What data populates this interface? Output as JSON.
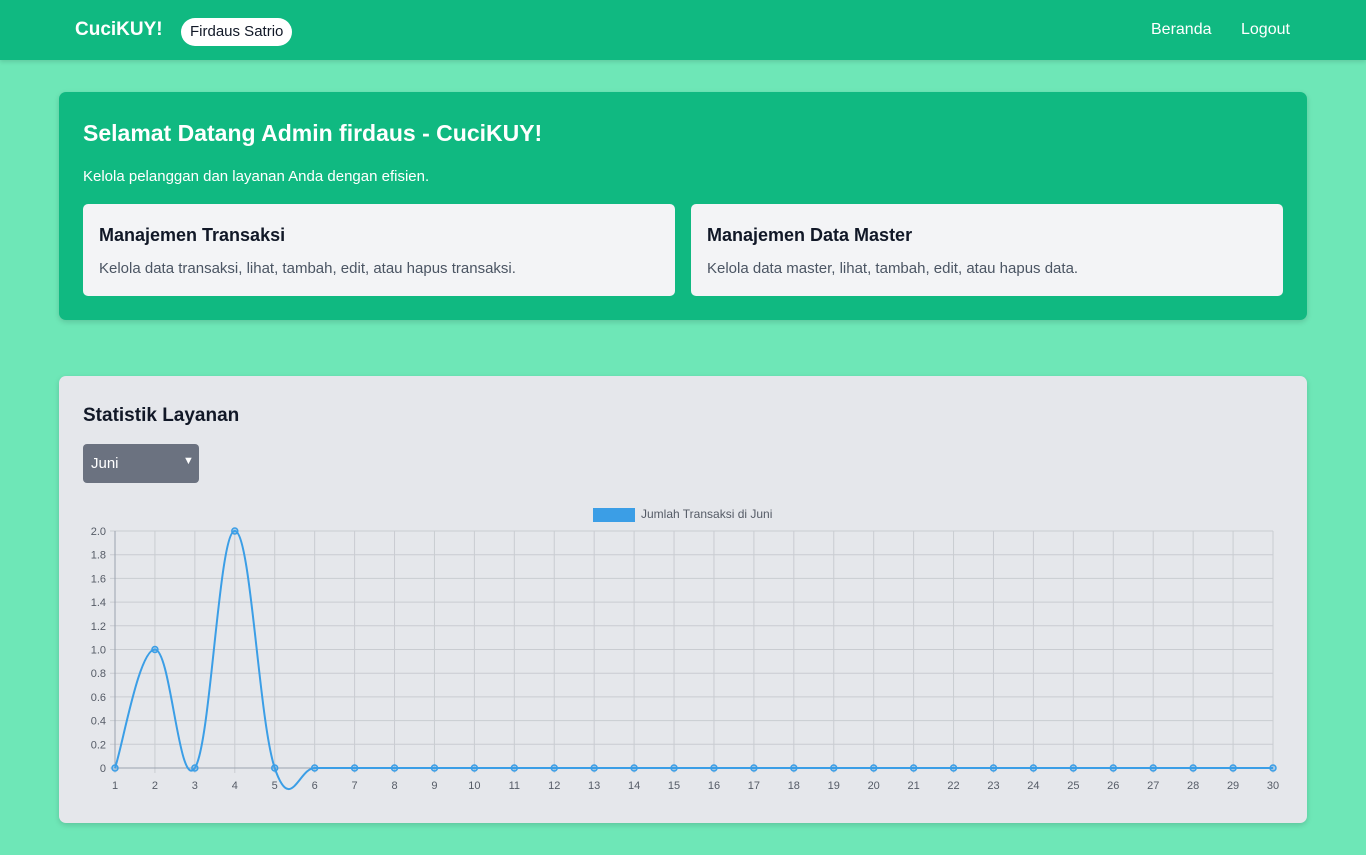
{
  "navbar": {
    "brand": "CuciKUY!",
    "user_name": "Firdaus Satrio",
    "links": {
      "home": "Beranda",
      "logout": "Logout"
    }
  },
  "hero": {
    "title": "Selamat Datang Admin firdaus - CuciKUY!",
    "subtitle": "Kelola pelanggan dan layanan Anda dengan efisien.",
    "cards": [
      {
        "title": "Manajemen Transaksi",
        "description": "Kelola data transaksi, lihat, tambah, edit, atau hapus transaksi."
      },
      {
        "title": "Manajemen Data Master",
        "description": "Kelola data master, lihat, tambah, edit, atau hapus data."
      }
    ]
  },
  "stats": {
    "title": "Statistik Layanan",
    "month_select": {
      "selected": "Juni"
    }
  },
  "colors": {
    "primary": "#10b981",
    "page_bg": "#6ee7b7",
    "series_line": "#3b9ee6",
    "select_bg": "#6b7280"
  },
  "icons": {
    "select": "chevron-down-icon"
  },
  "chart_data": {
    "type": "line",
    "x": [
      1,
      2,
      3,
      4,
      5,
      6,
      7,
      8,
      9,
      10,
      11,
      12,
      13,
      14,
      15,
      16,
      17,
      18,
      19,
      20,
      21,
      22,
      23,
      24,
      25,
      26,
      27,
      28,
      29,
      30
    ],
    "series": [
      {
        "name": "Jumlah Transaksi di Juni",
        "values": [
          0,
          1,
          0,
          2,
          0,
          0,
          0,
          0,
          0,
          0,
          0,
          0,
          0,
          0,
          0,
          0,
          0,
          0,
          0,
          0,
          0,
          0,
          0,
          0,
          0,
          0,
          0,
          0,
          0,
          0
        ]
      }
    ],
    "ylim": [
      0,
      2
    ],
    "y_ticks": [
      "0",
      "0.2",
      "0.4",
      "0.6",
      "0.8",
      "1.0",
      "1.2",
      "1.4",
      "1.6",
      "1.8",
      "2.0"
    ],
    "grid": true,
    "legend": "top-center"
  }
}
